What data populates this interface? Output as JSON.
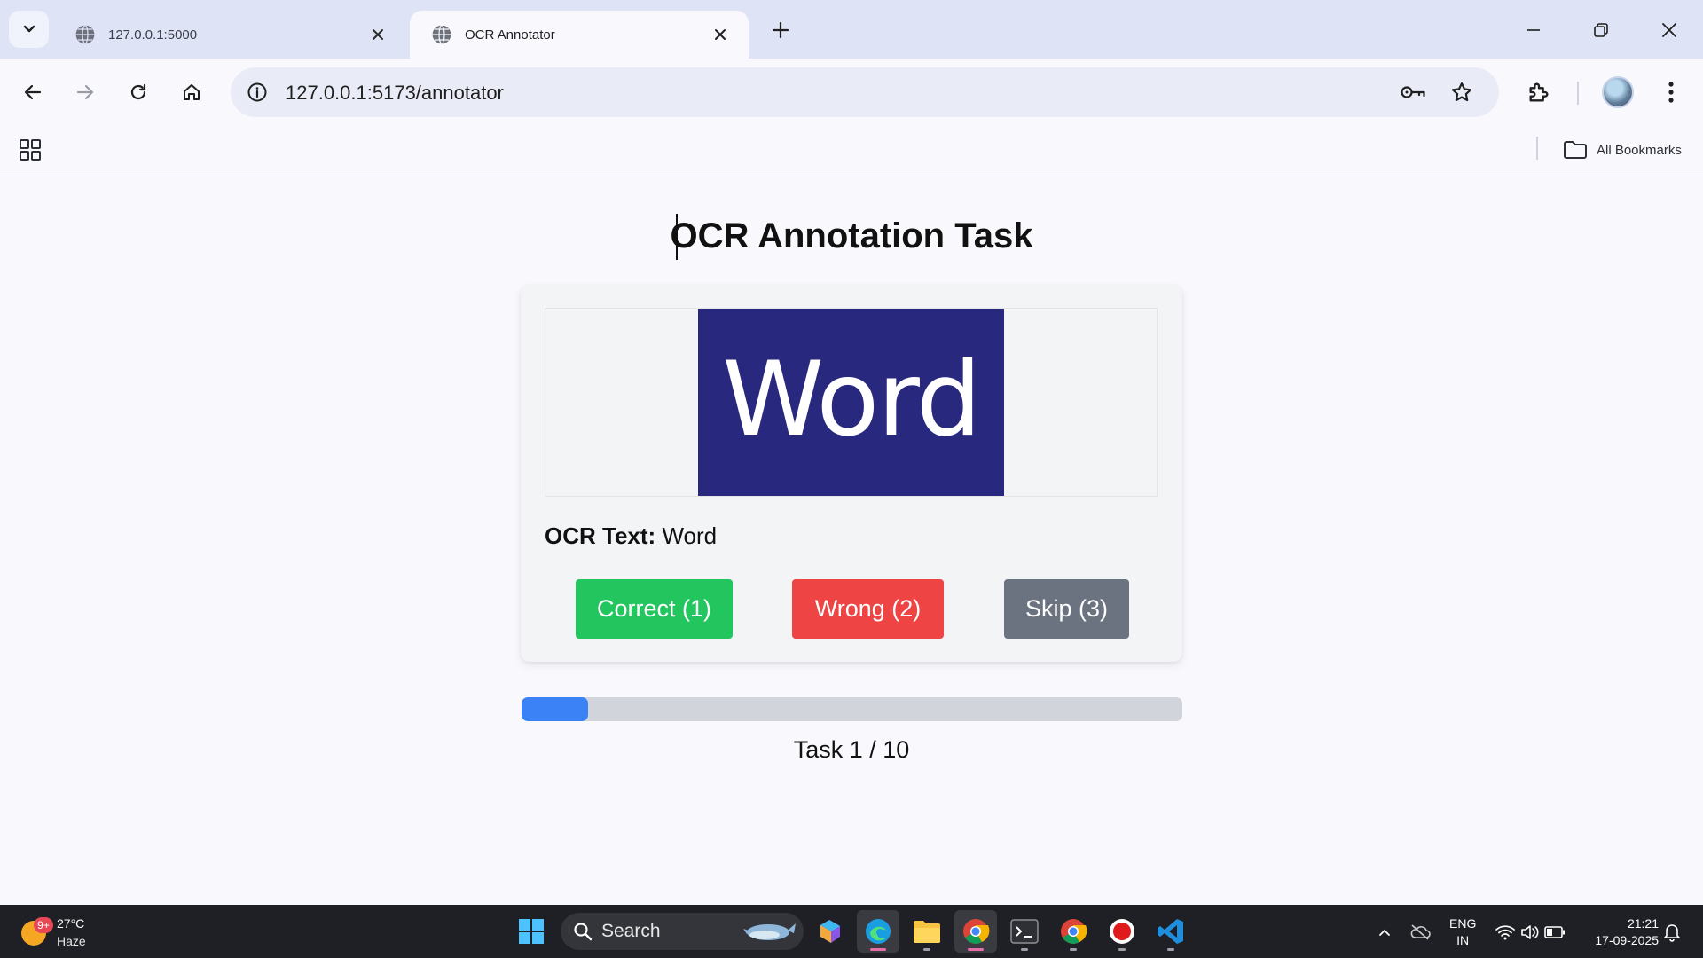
{
  "browser": {
    "tabs": [
      {
        "title": "127.0.0.1:5000",
        "active": false
      },
      {
        "title": "OCR Annotator",
        "active": true
      }
    ],
    "address": "127.0.0.1:5173/annotator",
    "bookmarks_label": "All Bookmarks"
  },
  "page": {
    "title": "OCR Annotation Task",
    "image_text": "Word",
    "ocr_label": "OCR Text:",
    "ocr_value": "Word",
    "buttons": {
      "correct": "Correct (1)",
      "wrong": "Wrong (2)",
      "skip": "Skip (3)"
    },
    "progress": {
      "current": 1,
      "total": 10,
      "label": "Task 1 / 10"
    }
  },
  "taskbar": {
    "weather_temp": "27°C",
    "weather_condition": "Haze",
    "weather_badge": "9+",
    "search_label": "Search",
    "language": "ENG",
    "region": "IN",
    "time": "21:21",
    "date": "17-09-2025"
  },
  "colors": {
    "correct": "#22c55e",
    "wrong": "#ef4444",
    "skip": "#6b7280",
    "progress": "#3b82f6",
    "image_bg": "#28287e"
  }
}
